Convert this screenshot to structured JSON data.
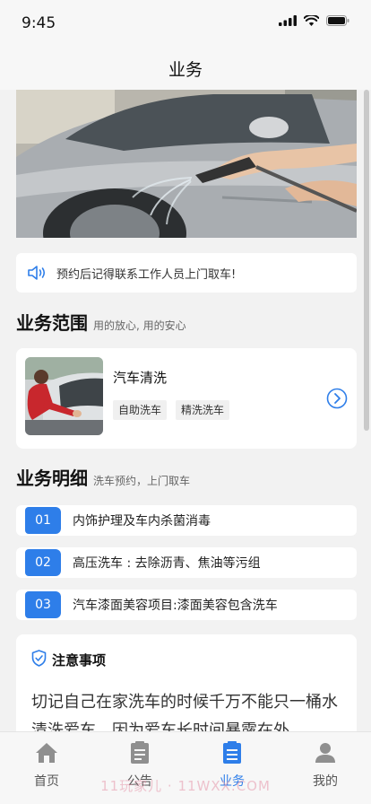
{
  "status": {
    "time": "9:45"
  },
  "nav": {
    "title": "业务"
  },
  "notice": {
    "text": "预约后记得联系工作人员上门取车!"
  },
  "scope": {
    "title": "业务范围",
    "subtitle": "用的放心, 用的安心",
    "service": {
      "name": "汽车清洗",
      "tags": [
        "自助洗车",
        "精洗洗车"
      ]
    }
  },
  "details": {
    "title": "业务明细",
    "subtitle": "洗车预约，上门取车",
    "items": [
      {
        "num": "01",
        "text": "内饰护理及车内杀菌消毒"
      },
      {
        "num": "02",
        "text": "高压洗车 : 去除沥青、焦油等污组"
      },
      {
        "num": "03",
        "text": "汽车漆面美容项目:漆面美容包含洗车"
      }
    ]
  },
  "caution": {
    "title": "注意事项",
    "body": "切记自己在家洗车的时候千万不能只一桶水清洗爱车，因为爱车长时间暴露在外"
  },
  "tabbar": {
    "items": [
      {
        "label": "首页",
        "icon": "home-icon"
      },
      {
        "label": "公告",
        "icon": "notice-board-icon"
      },
      {
        "label": "业务",
        "icon": "business-list-icon",
        "active": true
      },
      {
        "label": "我的",
        "icon": "user-icon"
      }
    ],
    "watermark": "11玩家儿 · 11WXX.COM"
  },
  "colors": {
    "accent": "#2e7ee9",
    "background": "#f2f2f2"
  }
}
